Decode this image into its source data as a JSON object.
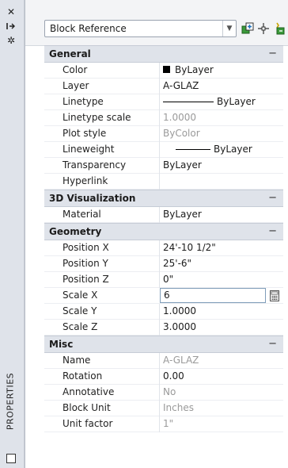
{
  "palette": {
    "title": "PROPERTIES",
    "tools": [
      {
        "icon": "close-icon",
        "glyph": "✕"
      },
      {
        "icon": "autohide-icon",
        "glyph": "⇥"
      },
      {
        "icon": "settings-icon",
        "glyph": "✲"
      }
    ]
  },
  "toolbar": {
    "selected_type": "Block Reference",
    "buttons": [
      "toggle-pickadd-icon",
      "select-objects-icon",
      "quick-select-icon"
    ]
  },
  "sections": [
    {
      "title": "General",
      "toggle": "−",
      "rows": [
        {
          "name": "Color",
          "value": "ByLayer",
          "kind": "swatch"
        },
        {
          "name": "Layer",
          "value": "A-GLAZ"
        },
        {
          "name": "Linetype",
          "value": "ByLayer",
          "kind": "line"
        },
        {
          "name": "Linetype scale",
          "value": "1.0000",
          "grey": true
        },
        {
          "name": "Plot style",
          "value": "ByColor",
          "grey": true
        },
        {
          "name": "Lineweight",
          "value": "ByLayer",
          "kind": "line-short"
        },
        {
          "name": "Transparency",
          "value": "ByLayer"
        },
        {
          "name": "Hyperlink",
          "value": ""
        }
      ]
    },
    {
      "title": "3D Visualization",
      "toggle": "−",
      "rows": [
        {
          "name": "Material",
          "value": "ByLayer"
        }
      ]
    },
    {
      "title": "Geometry",
      "toggle": "−",
      "rows": [
        {
          "name": "Position X",
          "value": "24'-10 1/2\""
        },
        {
          "name": "Position Y",
          "value": "25'-6\""
        },
        {
          "name": "Position Z",
          "value": "0\""
        },
        {
          "name": "Scale X",
          "value": "6",
          "kind": "edit"
        },
        {
          "name": "Scale Y",
          "value": "1.0000"
        },
        {
          "name": "Scale Z",
          "value": "3.0000"
        }
      ]
    },
    {
      "title": "Misc",
      "toggle": "−",
      "rows": [
        {
          "name": "Name",
          "value": "A-GLAZ",
          "grey": true
        },
        {
          "name": "Rotation",
          "value": "0.00"
        },
        {
          "name": "Annotative",
          "value": "No",
          "grey": true
        },
        {
          "name": "Block Unit",
          "value": "Inches",
          "grey": true
        },
        {
          "name": "Unit factor",
          "value": "1\"",
          "grey": true
        }
      ]
    }
  ],
  "colors": {
    "section_bg": "#dfe3ea",
    "edit_border": "#7f9db9",
    "readonly_text": "#9a9a9a"
  }
}
